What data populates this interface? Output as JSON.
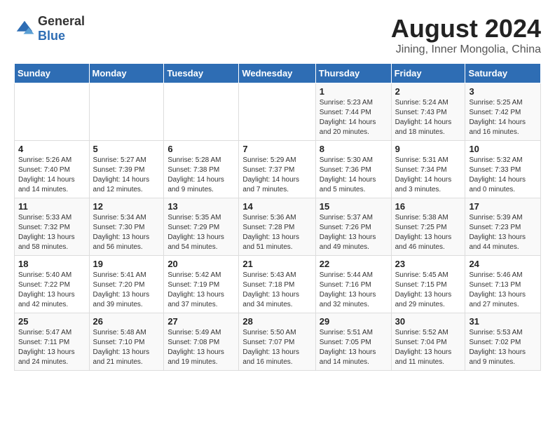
{
  "header": {
    "logo": {
      "text_general": "General",
      "text_blue": "Blue"
    },
    "title": "August 2024",
    "location": "Jining, Inner Mongolia, China"
  },
  "calendar": {
    "days_of_week": [
      "Sunday",
      "Monday",
      "Tuesday",
      "Wednesday",
      "Thursday",
      "Friday",
      "Saturday"
    ],
    "weeks": [
      [
        {
          "day": "",
          "info": ""
        },
        {
          "day": "",
          "info": ""
        },
        {
          "day": "",
          "info": ""
        },
        {
          "day": "",
          "info": ""
        },
        {
          "day": "1",
          "info": "Sunrise: 5:23 AM\nSunset: 7:44 PM\nDaylight: 14 hours\nand 20 minutes."
        },
        {
          "day": "2",
          "info": "Sunrise: 5:24 AM\nSunset: 7:43 PM\nDaylight: 14 hours\nand 18 minutes."
        },
        {
          "day": "3",
          "info": "Sunrise: 5:25 AM\nSunset: 7:42 PM\nDaylight: 14 hours\nand 16 minutes."
        }
      ],
      [
        {
          "day": "4",
          "info": "Sunrise: 5:26 AM\nSunset: 7:40 PM\nDaylight: 14 hours\nand 14 minutes."
        },
        {
          "day": "5",
          "info": "Sunrise: 5:27 AM\nSunset: 7:39 PM\nDaylight: 14 hours\nand 12 minutes."
        },
        {
          "day": "6",
          "info": "Sunrise: 5:28 AM\nSunset: 7:38 PM\nDaylight: 14 hours\nand 9 minutes."
        },
        {
          "day": "7",
          "info": "Sunrise: 5:29 AM\nSunset: 7:37 PM\nDaylight: 14 hours\nand 7 minutes."
        },
        {
          "day": "8",
          "info": "Sunrise: 5:30 AM\nSunset: 7:36 PM\nDaylight: 14 hours\nand 5 minutes."
        },
        {
          "day": "9",
          "info": "Sunrise: 5:31 AM\nSunset: 7:34 PM\nDaylight: 14 hours\nand 3 minutes."
        },
        {
          "day": "10",
          "info": "Sunrise: 5:32 AM\nSunset: 7:33 PM\nDaylight: 14 hours\nand 0 minutes."
        }
      ],
      [
        {
          "day": "11",
          "info": "Sunrise: 5:33 AM\nSunset: 7:32 PM\nDaylight: 13 hours\nand 58 minutes."
        },
        {
          "day": "12",
          "info": "Sunrise: 5:34 AM\nSunset: 7:30 PM\nDaylight: 13 hours\nand 56 minutes."
        },
        {
          "day": "13",
          "info": "Sunrise: 5:35 AM\nSunset: 7:29 PM\nDaylight: 13 hours\nand 54 minutes."
        },
        {
          "day": "14",
          "info": "Sunrise: 5:36 AM\nSunset: 7:28 PM\nDaylight: 13 hours\nand 51 minutes."
        },
        {
          "day": "15",
          "info": "Sunrise: 5:37 AM\nSunset: 7:26 PM\nDaylight: 13 hours\nand 49 minutes."
        },
        {
          "day": "16",
          "info": "Sunrise: 5:38 AM\nSunset: 7:25 PM\nDaylight: 13 hours\nand 46 minutes."
        },
        {
          "day": "17",
          "info": "Sunrise: 5:39 AM\nSunset: 7:23 PM\nDaylight: 13 hours\nand 44 minutes."
        }
      ],
      [
        {
          "day": "18",
          "info": "Sunrise: 5:40 AM\nSunset: 7:22 PM\nDaylight: 13 hours\nand 42 minutes."
        },
        {
          "day": "19",
          "info": "Sunrise: 5:41 AM\nSunset: 7:20 PM\nDaylight: 13 hours\nand 39 minutes."
        },
        {
          "day": "20",
          "info": "Sunrise: 5:42 AM\nSunset: 7:19 PM\nDaylight: 13 hours\nand 37 minutes."
        },
        {
          "day": "21",
          "info": "Sunrise: 5:43 AM\nSunset: 7:18 PM\nDaylight: 13 hours\nand 34 minutes."
        },
        {
          "day": "22",
          "info": "Sunrise: 5:44 AM\nSunset: 7:16 PM\nDaylight: 13 hours\nand 32 minutes."
        },
        {
          "day": "23",
          "info": "Sunrise: 5:45 AM\nSunset: 7:15 PM\nDaylight: 13 hours\nand 29 minutes."
        },
        {
          "day": "24",
          "info": "Sunrise: 5:46 AM\nSunset: 7:13 PM\nDaylight: 13 hours\nand 27 minutes."
        }
      ],
      [
        {
          "day": "25",
          "info": "Sunrise: 5:47 AM\nSunset: 7:11 PM\nDaylight: 13 hours\nand 24 minutes."
        },
        {
          "day": "26",
          "info": "Sunrise: 5:48 AM\nSunset: 7:10 PM\nDaylight: 13 hours\nand 21 minutes."
        },
        {
          "day": "27",
          "info": "Sunrise: 5:49 AM\nSunset: 7:08 PM\nDaylight: 13 hours\nand 19 minutes."
        },
        {
          "day": "28",
          "info": "Sunrise: 5:50 AM\nSunset: 7:07 PM\nDaylight: 13 hours\nand 16 minutes."
        },
        {
          "day": "29",
          "info": "Sunrise: 5:51 AM\nSunset: 7:05 PM\nDaylight: 13 hours\nand 14 minutes."
        },
        {
          "day": "30",
          "info": "Sunrise: 5:52 AM\nSunset: 7:04 PM\nDaylight: 13 hours\nand 11 minutes."
        },
        {
          "day": "31",
          "info": "Sunrise: 5:53 AM\nSunset: 7:02 PM\nDaylight: 13 hours\nand 9 minutes."
        }
      ]
    ]
  }
}
